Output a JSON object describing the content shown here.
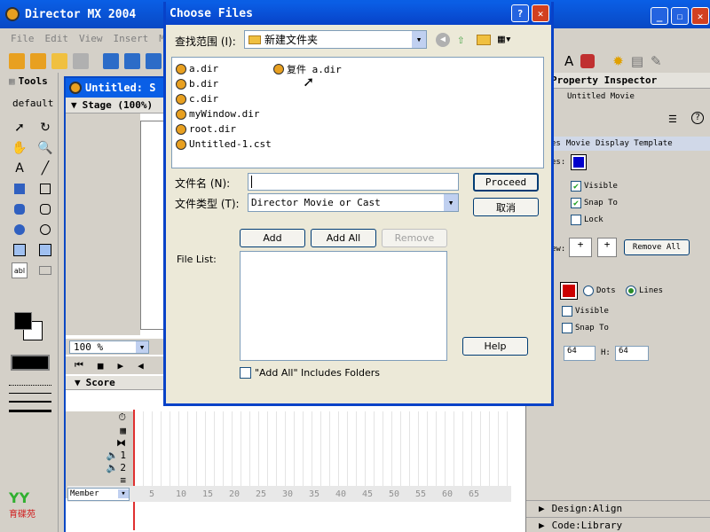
{
  "director": {
    "title": "Director MX 2004",
    "menu": [
      "File",
      "Edit",
      "View",
      "Insert",
      "Mod"
    ],
    "tools_label": "Tools",
    "tools_default": "default",
    "untitled_title": "Untitled: S",
    "stage_label": "Stage (100%)",
    "zoom_value": "100 %",
    "score_label": "Score",
    "member_label": "Member",
    "frame_numbers": [
      "5",
      "10",
      "15",
      "20",
      "25",
      "30",
      "35",
      "40",
      "45",
      "50",
      "55",
      "60",
      "65"
    ],
    "channel_labels": [
      "1",
      "2"
    ],
    "logo_text": "育碟苑"
  },
  "inspector": {
    "title": "Property Inspector",
    "subtitle": "Untitled Movie",
    "tabs": [
      "es",
      "Movie",
      "Display Template"
    ],
    "es_label": "es:",
    "visible1": "Visible",
    "snap1": "Snap To",
    "lock": "Lock",
    "view_label": "ew:",
    "remove_all": "Remove All",
    "dots": "Dots",
    "lines": "Lines",
    "visible2": "Visible",
    "snap2": "Snap To",
    "w_value": "64",
    "h_label": "H:",
    "h_value": "64",
    "design_align": "Design:Align",
    "code_library": "Code:Library",
    "colors": {
      "stage": "#0000cc",
      "grid": "#cc0000"
    }
  },
  "dialog": {
    "title": "Choose Files",
    "lookin_label": "查找范围 (I):",
    "lookin_value": "新建文件夹",
    "files_col1": [
      "a.dir",
      "b.dir",
      "c.dir",
      "myWindow.dir",
      "root.dir",
      "Untitled-1.cst"
    ],
    "files_col2": [
      "复件 a.dir"
    ],
    "filename_label": "文件名 (N):",
    "filename_value": "",
    "filetype_label": "文件类型 (T):",
    "filetype_value": "Director Movie or Cast",
    "proceed": "Proceed",
    "cancel": "取消",
    "add": "Add",
    "add_all": "Add All",
    "remove": "Remove",
    "file_list_label": "File List:",
    "help": "Help",
    "include_folders": "\"Add All\" Includes Folders"
  }
}
